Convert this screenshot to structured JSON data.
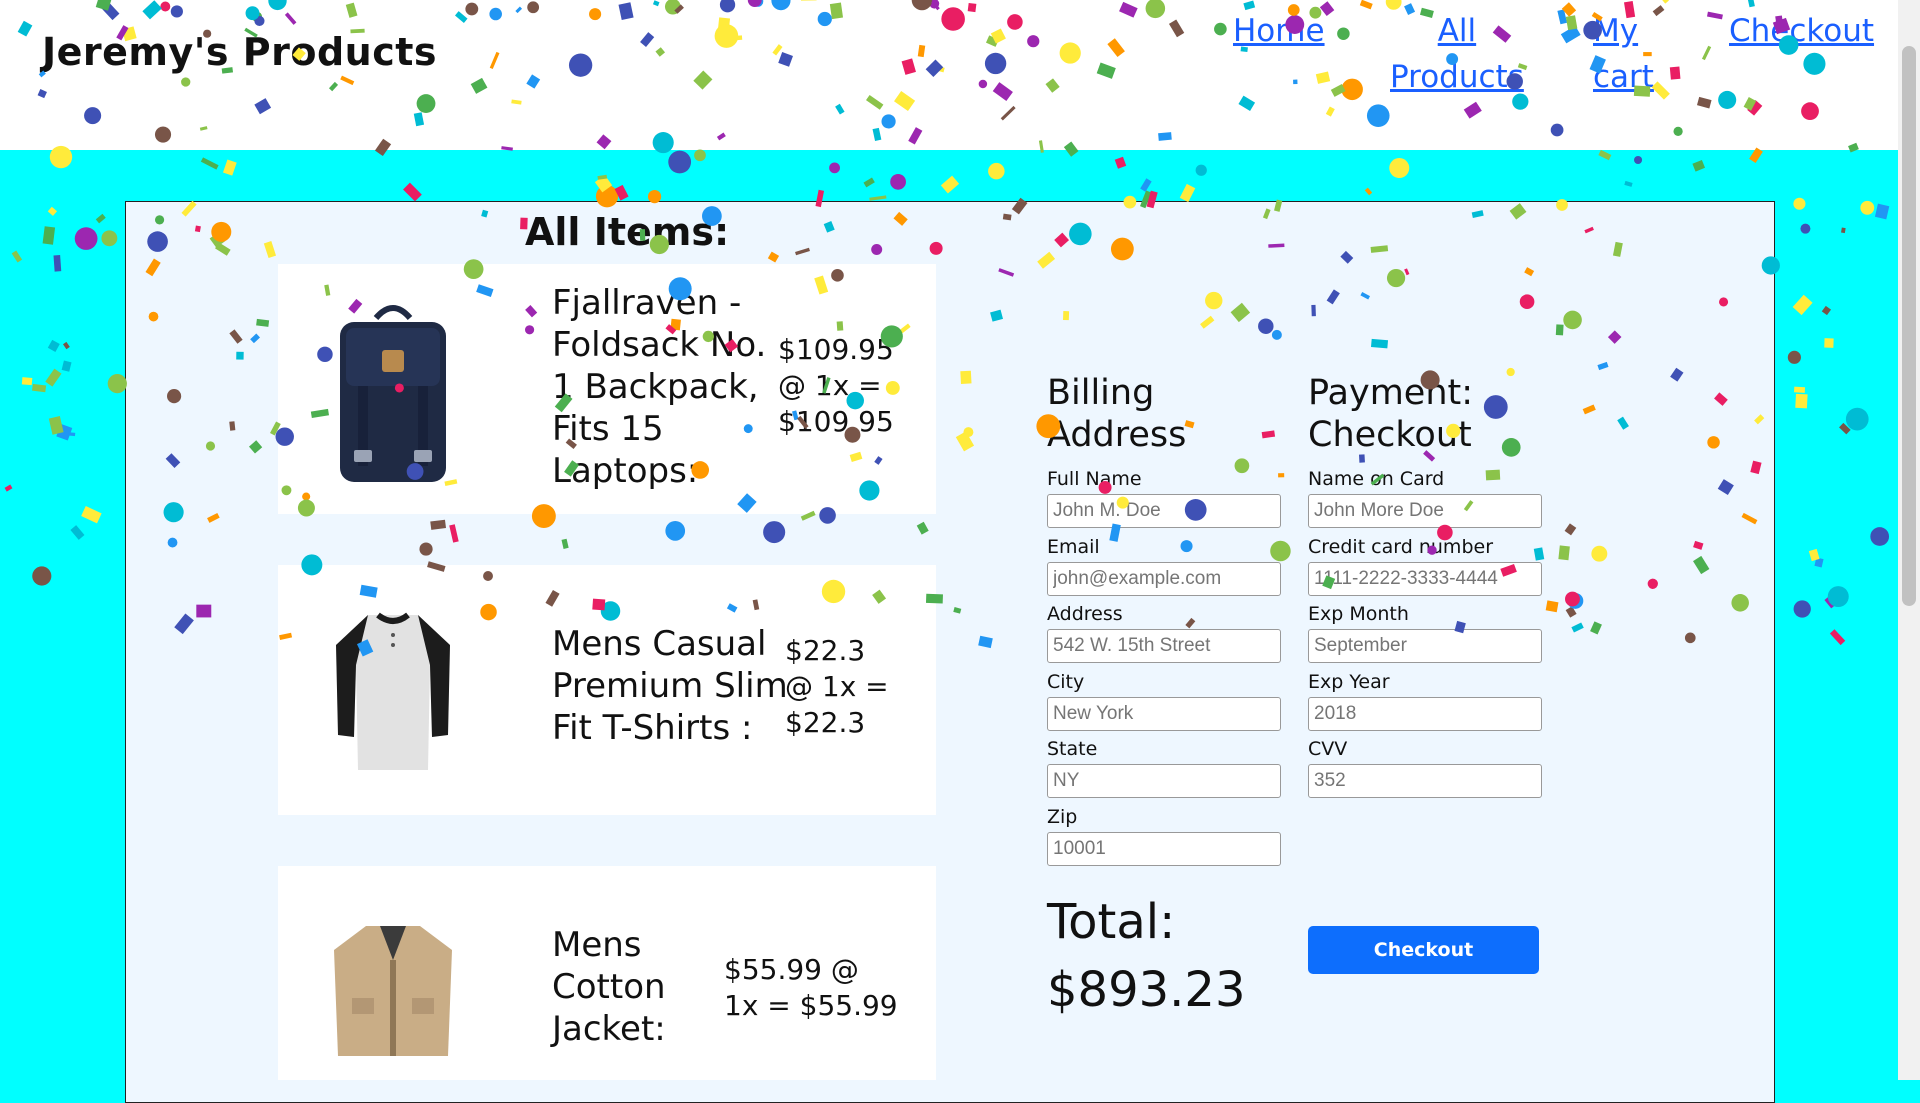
{
  "brand": "Jeremy's Products",
  "nav": [
    {
      "lines": [
        "Home"
      ]
    },
    {
      "lines": [
        "All",
        "Products"
      ]
    },
    {
      "lines": [
        "My",
        "cart"
      ]
    },
    {
      "lines": [
        "Checkout"
      ]
    }
  ],
  "all_items_title": "All Items:",
  "items": [
    {
      "name_lines": [
        "Fjallraven -",
        "Foldsack No.",
        "1 Backpack,",
        "Fits 15",
        "Laptops:"
      ],
      "price_lines": [
        "$109.95",
        "@ 1x =",
        "$109.95"
      ]
    },
    {
      "name_lines": [
        "Mens Casual",
        "Premium Slim",
        "Fit T-Shirts :"
      ],
      "price_lines": [
        "$22.3",
        "@ 1x =",
        "$22.3"
      ]
    },
    {
      "name_lines": [
        "Mens",
        "Cotton",
        "Jacket:"
      ],
      "price_lines": [
        "$55.99 @",
        "1x = $55.99"
      ]
    }
  ],
  "billing": {
    "title_lines": [
      "Billing",
      "Address"
    ],
    "fields": [
      {
        "label": "Full Name",
        "placeholder": "John M. Doe"
      },
      {
        "label": "Email",
        "placeholder": "john@example.com"
      },
      {
        "label": "Address",
        "placeholder": "542 W. 15th Street"
      },
      {
        "label": "City",
        "placeholder": "New York"
      },
      {
        "label": "State",
        "placeholder": "NY"
      },
      {
        "label": "Zip",
        "placeholder": "10001"
      }
    ]
  },
  "payment": {
    "title_lines": [
      "Payment:",
      "Checkout"
    ],
    "fields": [
      {
        "label": "Name on Card",
        "placeholder": "John More Doe"
      },
      {
        "label": "Credit card number",
        "placeholder": "1111-2222-3333-4444"
      },
      {
        "label": "Exp Month",
        "placeholder": "September"
      },
      {
        "label": "Exp Year",
        "placeholder": "2018"
      },
      {
        "label": "CVV",
        "placeholder": "352"
      }
    ]
  },
  "total_label": "Total:",
  "total_value": "$893.23",
  "checkout_button": "Checkout",
  "colors": {
    "page_bg": "#00ffff",
    "panel_bg": "#eef7ff",
    "link": "#1a5fff",
    "button": "#0d6efd"
  }
}
